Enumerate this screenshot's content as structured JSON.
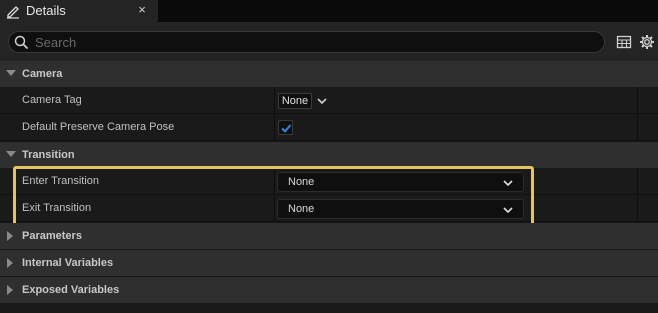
{
  "tab": {
    "title": "Details",
    "close_label": "×",
    "icon": "pencil-icon"
  },
  "search": {
    "placeholder": "Search",
    "value": ""
  },
  "toolbar": {
    "icons": [
      "table-view-icon",
      "gear-icon"
    ]
  },
  "categories": {
    "camera": {
      "label": "Camera",
      "expanded": true,
      "properties": {
        "camera_tag": {
          "label": "Camera Tag",
          "value": "None"
        },
        "preserve_pose": {
          "label": "Default Preserve Camera Pose",
          "checked": true
        }
      }
    },
    "transition": {
      "label": "Transition",
      "expanded": true,
      "properties": {
        "enter": {
          "label": "Enter Transition",
          "value": "None"
        },
        "exit": {
          "label": "Exit Transition",
          "value": "None"
        }
      }
    },
    "parameters": {
      "label": "Parameters",
      "expanded": false
    },
    "internal": {
      "label": "Internal Variables",
      "expanded": false
    },
    "exposed": {
      "label": "Exposed Variables",
      "expanded": false
    }
  },
  "colors": {
    "highlight": "#e8c35a",
    "checkbox_accent": "#2f86e0",
    "panel": "#1a1a1a",
    "category": "#2f2f2f"
  }
}
